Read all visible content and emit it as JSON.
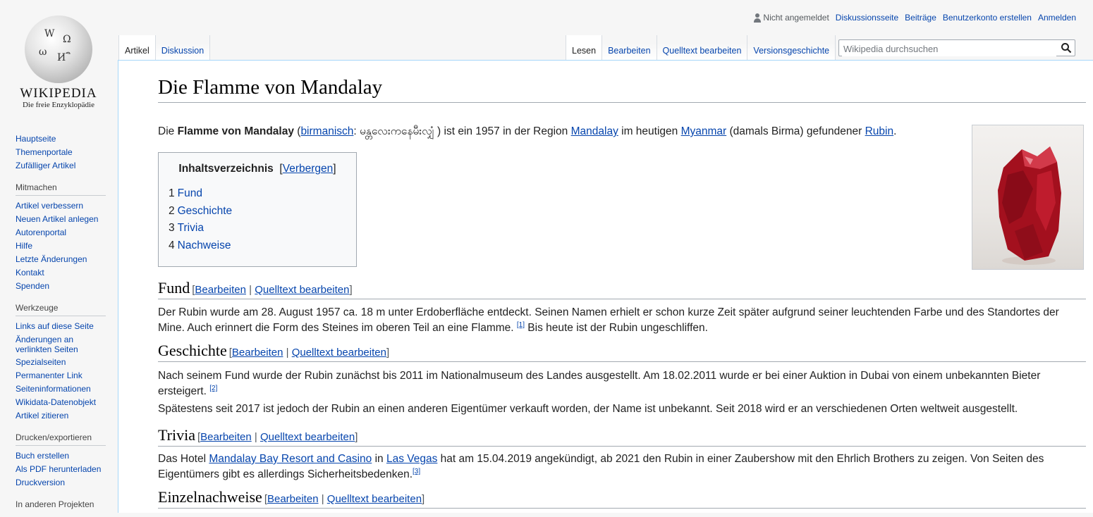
{
  "logo": {
    "wordmark": "WIKIPEDIA",
    "tagline": "Die freie Enzyklopädie"
  },
  "personal": {
    "status": "Nicht angemeldet",
    "links": [
      "Diskussionsseite",
      "Beiträge",
      "Benutzerkonto erstellen",
      "Anmelden"
    ]
  },
  "tabs_left": [
    {
      "label": "Artikel",
      "selected": true
    },
    {
      "label": "Diskussion",
      "selected": false
    }
  ],
  "tabs_right": [
    {
      "label": "Lesen",
      "selected": true
    },
    {
      "label": "Bearbeiten",
      "selected": false
    },
    {
      "label": "Quelltext bearbeiten",
      "selected": false
    },
    {
      "label": "Versionsgeschichte",
      "selected": false
    }
  ],
  "search": {
    "placeholder": "Wikipedia durchsuchen"
  },
  "sidebar": {
    "nav": [
      "Hauptseite",
      "Themenportale",
      "Zufälliger Artikel"
    ],
    "mitmachen_head": "Mitmachen",
    "mitmachen": [
      "Artikel verbessern",
      "Neuen Artikel anlegen",
      "Autorenportal",
      "Hilfe",
      "Letzte Änderungen",
      "Kontakt",
      "Spenden"
    ],
    "werkzeuge_head": "Werkzeuge",
    "werkzeuge": [
      "Links auf diese Seite",
      "Änderungen an verlinkten Seiten",
      "Spezialseiten",
      "Permanenter Link",
      "Seiteninformationen",
      "Wikidata-Datenobjekt",
      "Artikel zitieren"
    ],
    "drucken_head": "Drucken/exportieren",
    "drucken": [
      "Buch erstellen",
      "Als PDF herunterladen",
      "Druckversion"
    ],
    "projekte_head": "In anderen Projekten"
  },
  "article": {
    "title": "Die Flamme von Mandalay",
    "intro": {
      "t1": "Die ",
      "bold": "Flamme von Mandalay",
      "t2": " (",
      "l1": "birmanisch",
      "t3": ": မန္တလေးကနေမီးလျှံ ) ist ein 1957 in der Region ",
      "l2": "Mandalay",
      "t4": " im heutigen ",
      "l3": "Myanmar",
      "t5": " (damals Birma) gefundener ",
      "l4": "Rubin",
      "t6": "."
    },
    "toc": {
      "title": "Inhaltsverzeichnis",
      "toggle_open": "[",
      "toggle": "Verbergen",
      "toggle_close": "]",
      "items": [
        {
          "num": "1",
          "label": "Fund"
        },
        {
          "num": "2",
          "label": "Geschichte"
        },
        {
          "num": "3",
          "label": "Trivia"
        },
        {
          "num": "4",
          "label": "Nachweise"
        }
      ]
    },
    "edit": {
      "open": "[",
      "edit": "Bearbeiten",
      "sep": " | ",
      "source": "Quelltext bearbeiten",
      "close": "]"
    },
    "sections": {
      "fund": {
        "heading": "Fund",
        "p1a": "Der Rubin wurde am 28. August 1957 ca. 18 m unter Erdoberfläche entdeckt. Seinen Namen erhielt er schon kurze Zeit später aufgrund seiner leuchtenden Farbe und des Standortes der Mine. Auch erinnert die Form des Steines im oberen Teil an eine Flamme. ",
        "ref": "[1]",
        "p1b": " Bis heute ist der Rubin ungeschliffen."
      },
      "geschichte": {
        "heading": "Geschichte",
        "p1": "Nach seinem Fund wurde der Rubin zunächst bis 2011 im Nationalmuseum des Landes ausgestellt. Am 18.02.2011 wurde er bei einer Auktion in Dubai von einem unbekannten Bieter ersteigert. ",
        "ref": "[2]",
        "p2": "Spätestens seit 2017 ist jedoch der Rubin an einen anderen Eigentümer verkauft worden, der Name ist unbekannt. Seit 2018 wird er an verschiedenen Orten weltweit ausgestellt."
      },
      "trivia": {
        "heading": "Trivia",
        "t1": "Das Hotel ",
        "l1": "Mandalay Bay Resort and Casino",
        "t2": " in ",
        "l2": "Las Vegas",
        "t3": " hat am 15.04.2019 angekündigt, ab 2021 den Rubin in einer Zaubershow mit den Ehrlich Brothers zu zeigen. Von Seiten des Eigentümers gibt es allerdings Sicherheitsbedenken.",
        "ref": "[3]"
      },
      "nachweise": {
        "heading": "Einzelnachweise"
      }
    }
  },
  "colors": {
    "link": "#0645ad",
    "border": "#a2a9b1",
    "tab_border": "#a7d7f9",
    "ruby": "#a3101e"
  }
}
